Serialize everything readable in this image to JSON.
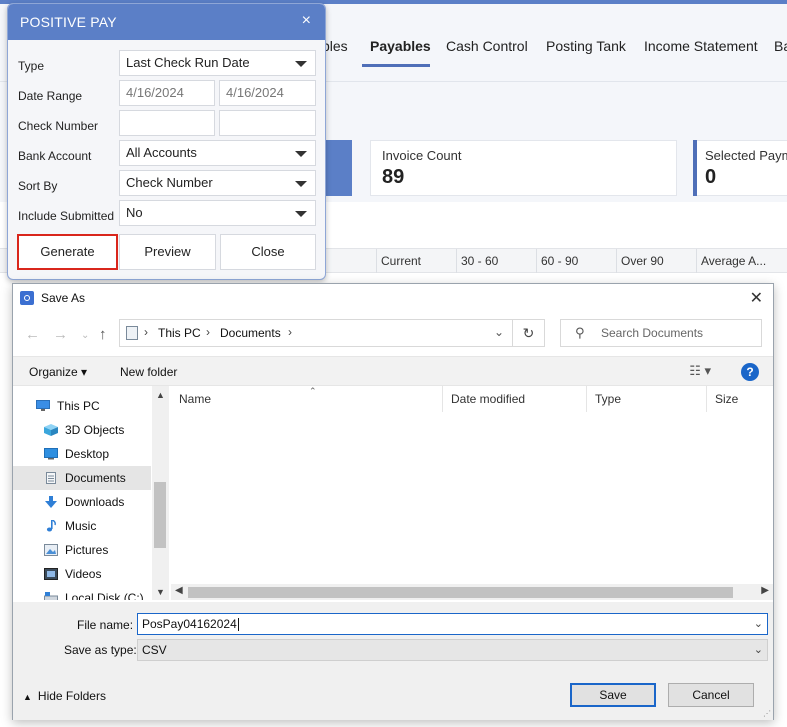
{
  "app": {
    "nav_tabs": [
      "bles",
      "Payables",
      "Cash Control",
      "Posting Tank",
      "Income Statement",
      "Ba"
    ],
    "active_tab": "Payables",
    "accent_color": "#5b7fc7",
    "cards": [
      {
        "label": "Invoice Count",
        "value": "89"
      },
      {
        "label": "Selected Paym",
        "value": "0"
      }
    ],
    "columns": [
      "Current",
      "30 - 60",
      "60 - 90",
      "Over 90",
      "Average A..."
    ]
  },
  "positive_pay": {
    "title": "POSITIVE PAY",
    "close_icon": "×",
    "fields": {
      "type_label": "Type",
      "type_value": "Last Check Run Date",
      "date_range_label": "Date Range",
      "date_from": "4/16/2024",
      "date_to": "4/16/2024",
      "check_number_label": "Check Number",
      "bank_account_label": "Bank Account",
      "bank_account_value": "All Accounts",
      "sort_by_label": "Sort By",
      "sort_by_value": "Check Number",
      "include_submitted_label": "Include Submitted",
      "include_submitted_value": "No"
    },
    "buttons": {
      "generate": "Generate",
      "preview": "Preview",
      "close": "Close"
    },
    "focus_color": "#d9261c"
  },
  "save_as": {
    "title": "Save As",
    "close_icon": "✕",
    "breadcrumbs": [
      "This PC",
      "Documents"
    ],
    "search_placeholder": "Search Documents",
    "commands": {
      "organize": "Organize ▾",
      "new_folder": "New folder"
    },
    "help_icon": "?",
    "tree": [
      {
        "label": "This PC",
        "icon": "computer-icon"
      },
      {
        "label": "3D Objects",
        "icon": "cube-icon"
      },
      {
        "label": "Desktop",
        "icon": "desktop-icon"
      },
      {
        "label": "Documents",
        "icon": "document-icon",
        "selected": true
      },
      {
        "label": "Downloads",
        "icon": "download-icon"
      },
      {
        "label": "Music",
        "icon": "music-icon"
      },
      {
        "label": "Pictures",
        "icon": "picture-icon"
      },
      {
        "label": "Videos",
        "icon": "video-icon"
      },
      {
        "label": "Local Disk (C:)",
        "icon": "disk-icon"
      }
    ],
    "list_columns": [
      "Name",
      "Date modified",
      "Type",
      "Size"
    ],
    "file_name_label": "File name:",
    "file_name_value": "PosPay04162024",
    "save_type_label": "Save as type:",
    "save_type_value": "CSV",
    "hide_folders": "Hide Folders",
    "save_button": "Save",
    "cancel_button": "Cancel"
  }
}
